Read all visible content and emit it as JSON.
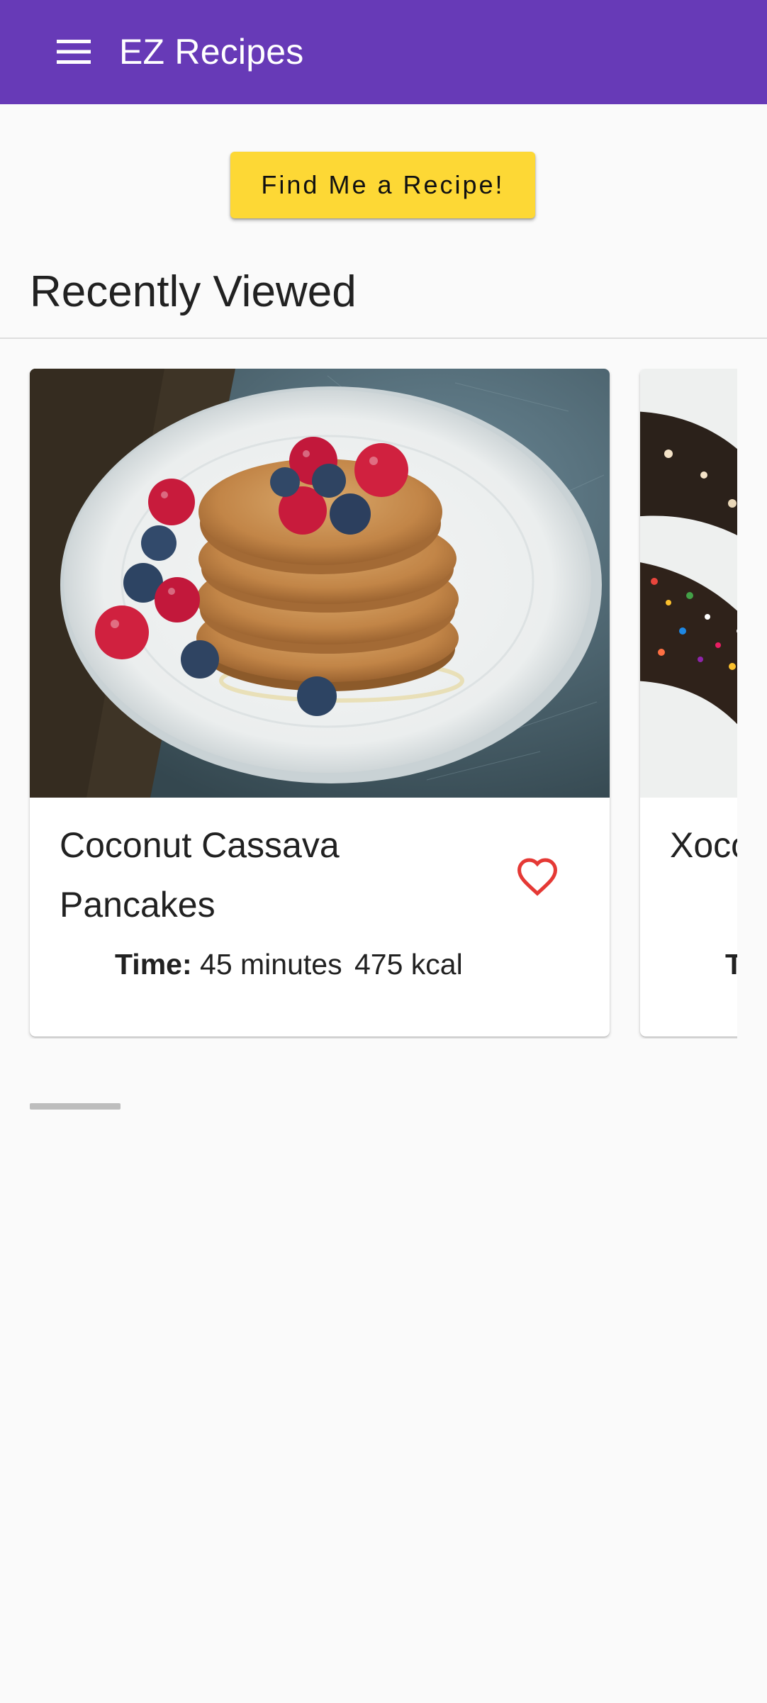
{
  "app_bar": {
    "title": "EZ Recipes",
    "menu_icon": "hamburger-menu-icon",
    "background": "#673ab7"
  },
  "find_button": {
    "label": "Find Me a Recipe!",
    "background": "#fdd835"
  },
  "recently_viewed": {
    "title": "Recently Viewed",
    "cards": [
      {
        "name": "Coconut Cassava Pancakes",
        "time_label": "Time:",
        "time_value": "45 minutes",
        "calories": "475 kcal",
        "favorite_icon": "heart-outline-icon",
        "favorite_color": "#e53935"
      },
      {
        "name": "Xoco Rod",
        "time_label": "T"
      }
    ]
  },
  "scroll_indicator": {
    "color": "#bdbdbd"
  }
}
